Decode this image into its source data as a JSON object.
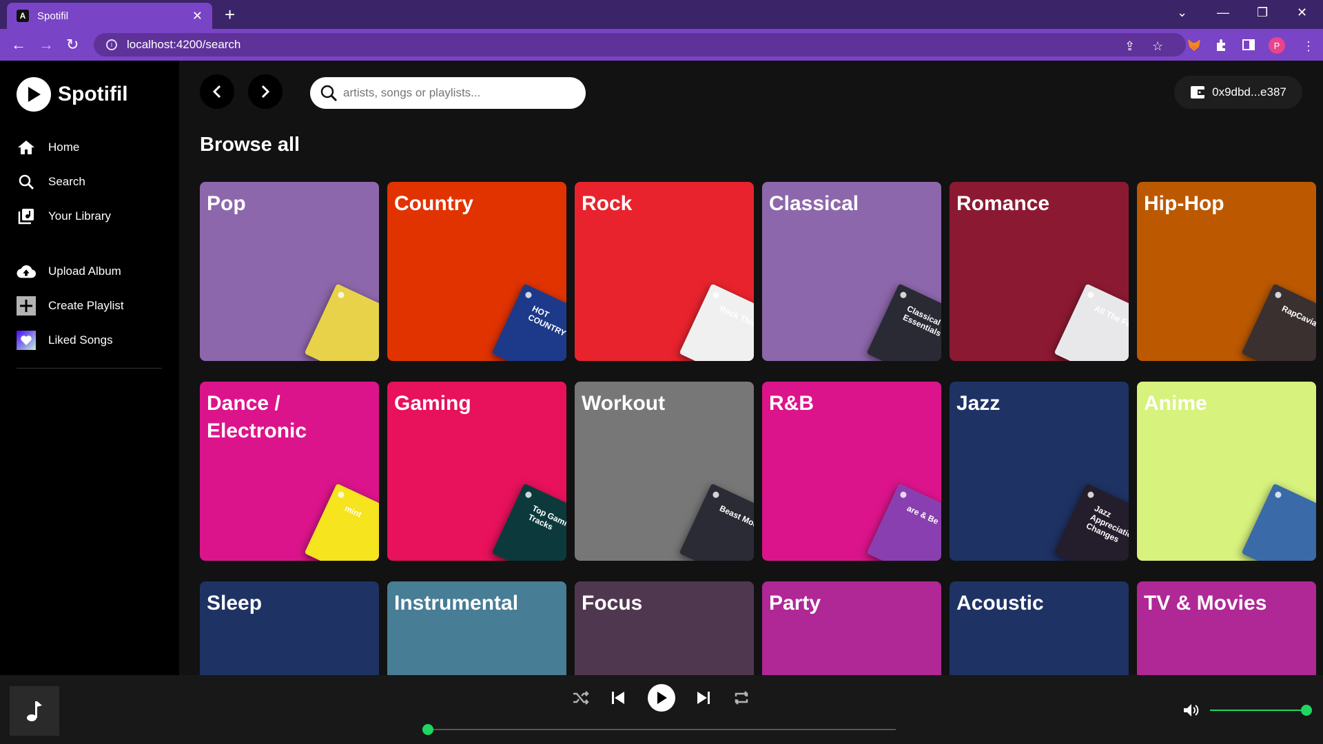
{
  "browser": {
    "tab_title": "Spotifil",
    "tab_favicon_letter": "A",
    "url": "localhost:4200/search",
    "profile_initial": "P"
  },
  "sidebar": {
    "brand": "Spotifil",
    "nav": [
      {
        "label": "Home",
        "icon": "home-icon"
      },
      {
        "label": "Search",
        "icon": "search-icon"
      },
      {
        "label": "Your Library",
        "icon": "library-icon"
      }
    ],
    "actions": [
      {
        "label": "Upload Album",
        "icon": "upload-cloud-icon"
      },
      {
        "label": "Create Playlist",
        "icon": "plus-box-icon"
      },
      {
        "label": "Liked Songs",
        "icon": "heart-icon"
      }
    ]
  },
  "topbar": {
    "search_placeholder": "artists, songs or playlists...",
    "search_value": "",
    "wallet_label": "0x9dbd...e387"
  },
  "main": {
    "heading": "Browse all",
    "categories": [
      {
        "title": "Pop",
        "color": "#8d67ab",
        "art_color": "#e8d24a",
        "art_label": ""
      },
      {
        "title": "Country",
        "color": "#e13300",
        "art_color": "#1d3a8a",
        "art_label": "HOT COUNTRY"
      },
      {
        "title": "Rock",
        "color": "#e8232d",
        "art_color": "#f0f0f0",
        "art_label": "Rock This"
      },
      {
        "title": "Classical",
        "color": "#8d67ab",
        "art_color": "#2a2a35",
        "art_label": "Classical Essentials"
      },
      {
        "title": "Romance",
        "color": "#8c1932",
        "art_color": "#e8e8ea",
        "art_label": "All The Feels"
      },
      {
        "title": "Hip-Hop",
        "color": "#bc5900",
        "art_color": "#3a3030",
        "art_label": "RapCaviar"
      },
      {
        "title": "Dance / Electronic",
        "color": "#dc148c",
        "art_color": "#f5e41e",
        "art_label": "mint"
      },
      {
        "title": "Gaming",
        "color": "#e8115b",
        "art_color": "#0c3a3c",
        "art_label": "Top Gaming Tracks"
      },
      {
        "title": "Workout",
        "color": "#777777",
        "art_color": "#2b2b35",
        "art_label": "Beast Mode"
      },
      {
        "title": "R&B",
        "color": "#dc148c",
        "art_color": "#8a3fb0",
        "art_label": "are & Be"
      },
      {
        "title": "Jazz",
        "color": "#1e3264",
        "art_color": "#241d2b",
        "art_label": "Jazz Appreciation: Changes"
      },
      {
        "title": "Anime",
        "color": "#d7f27d",
        "art_color": "#3a6aa8",
        "art_label": ""
      },
      {
        "title": "Sleep",
        "color": "#1e3264",
        "art_color": "#1e3264",
        "art_label": ""
      },
      {
        "title": "Instrumental",
        "color": "#477d95",
        "art_color": "#477d95",
        "art_label": ""
      },
      {
        "title": "Focus",
        "color": "#503750",
        "art_color": "#503750",
        "art_label": ""
      },
      {
        "title": "Party",
        "color": "#af2896",
        "art_color": "#af2896",
        "art_label": ""
      },
      {
        "title": "Acoustic",
        "color": "#1e3264",
        "art_color": "#1e3264",
        "art_label": ""
      },
      {
        "title": "TV & Movies",
        "color": "#af2896",
        "art_color": "#af2896",
        "art_label": ""
      }
    ]
  },
  "player": {
    "progress": 0.0,
    "volume": 1.0,
    "accent": "#1ed760"
  }
}
